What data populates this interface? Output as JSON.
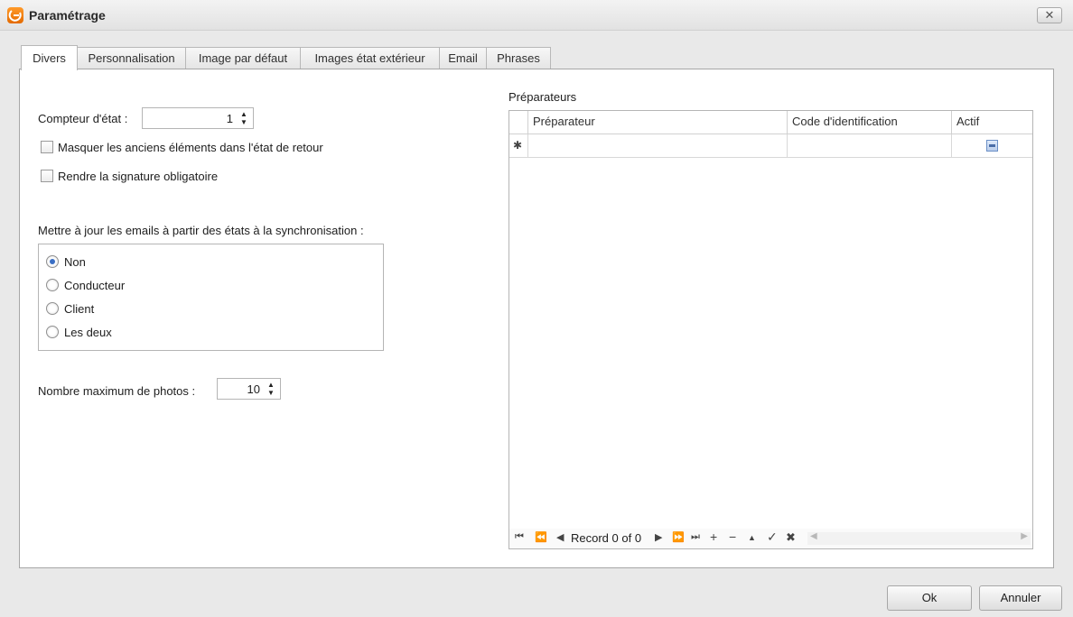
{
  "window": {
    "title": "Paramétrage",
    "close_label": "✕"
  },
  "tabs": [
    {
      "label": "Divers",
      "active": true
    },
    {
      "label": "Personnalisation"
    },
    {
      "label": "Image par défaut"
    },
    {
      "label": "Images état extérieur"
    },
    {
      "label": "Email"
    },
    {
      "label": "Phrases"
    }
  ],
  "divers": {
    "counter": {
      "label": "Compteur d'état :",
      "value": "1"
    },
    "hide_old_items": {
      "label": "Masquer les anciens éléments dans l'état de retour",
      "checked": false
    },
    "signature_required": {
      "label": "Rendre la signature obligatoire",
      "checked": false
    },
    "email_update": {
      "label": "Mettre à jour les emails à partir des états à la synchronisation :",
      "options": [
        {
          "label": "Non",
          "checked": true
        },
        {
          "label": "Conducteur",
          "checked": false
        },
        {
          "label": "Client",
          "checked": false
        },
        {
          "label": "Les deux",
          "checked": false
        }
      ]
    },
    "max_photos": {
      "label": "Nombre maximum de photos :",
      "value": "10"
    }
  },
  "preparateurs": {
    "title": "Préparateurs",
    "columns": [
      "Préparateur",
      "Code d'identification",
      "Actif"
    ],
    "rows": [],
    "navigator": {
      "record_text": "Record 0 of 0"
    }
  },
  "buttons": {
    "ok": "Ok",
    "cancel": "Annuler"
  },
  "colors": {
    "accent": "#3a6fc4",
    "brand": "#f08a1c"
  }
}
